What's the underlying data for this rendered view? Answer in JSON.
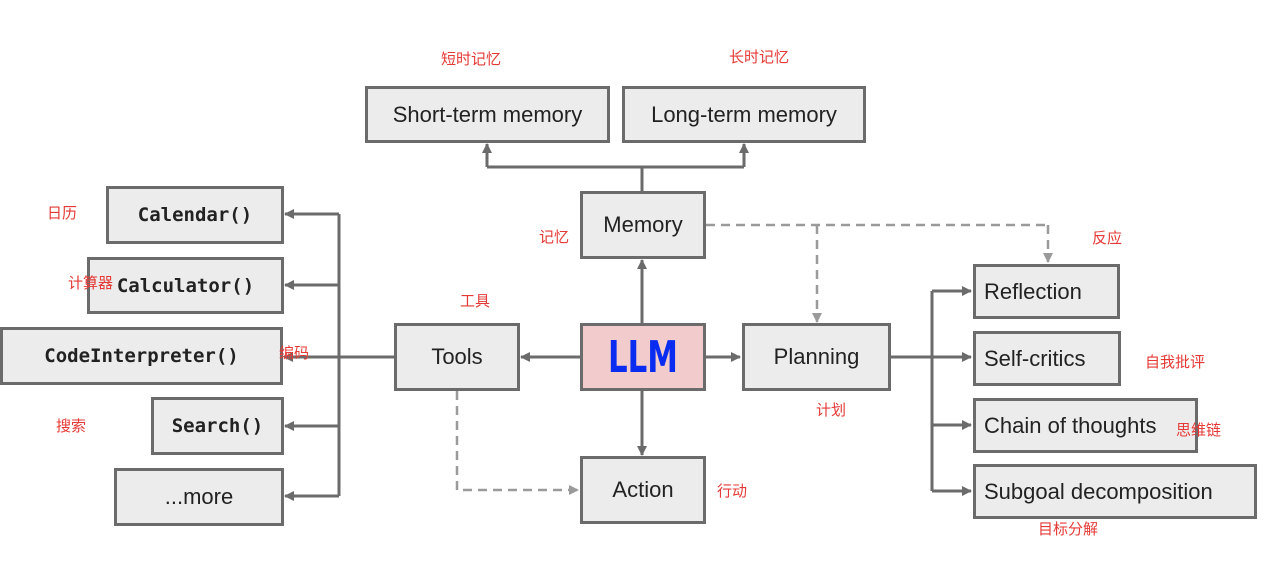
{
  "nodes": {
    "short_term_memory": "Short-term memory",
    "long_term_memory": "Long-term memory",
    "memory": "Memory",
    "llm": "LLM",
    "tools": "Tools",
    "planning": "Planning",
    "action": "Action",
    "calendar": "Calendar()",
    "calculator": "Calculator()",
    "code_interpreter": "CodeInterpreter()",
    "search": "Search()",
    "more": "...more",
    "reflection": "Reflection",
    "self_critics": "Self-critics",
    "chain_of_thoughts": "Chain of thoughts",
    "subgoal_decomposition": "Subgoal decomposition"
  },
  "annotations": {
    "short_term_memory": "短时记忆",
    "long_term_memory": "长时记忆",
    "calendar": "日历",
    "calculator": "计算器",
    "code_interpreter": "编码",
    "search": "搜索",
    "tools": "工具",
    "memory": "记忆",
    "reflection": "反应",
    "self_critics": "自我批评",
    "planning": "计划",
    "chain_of_thoughts": "思维链",
    "action": "行动",
    "subgoal_decomposition": "目标分解"
  },
  "colors": {
    "llm_fill": "#f2cccc",
    "llm_text": "#0a2cf0",
    "annotation": "#e53935",
    "box_fill": "#ececec",
    "line": "#6b6b6b",
    "dashed": "#9a9a9a"
  }
}
